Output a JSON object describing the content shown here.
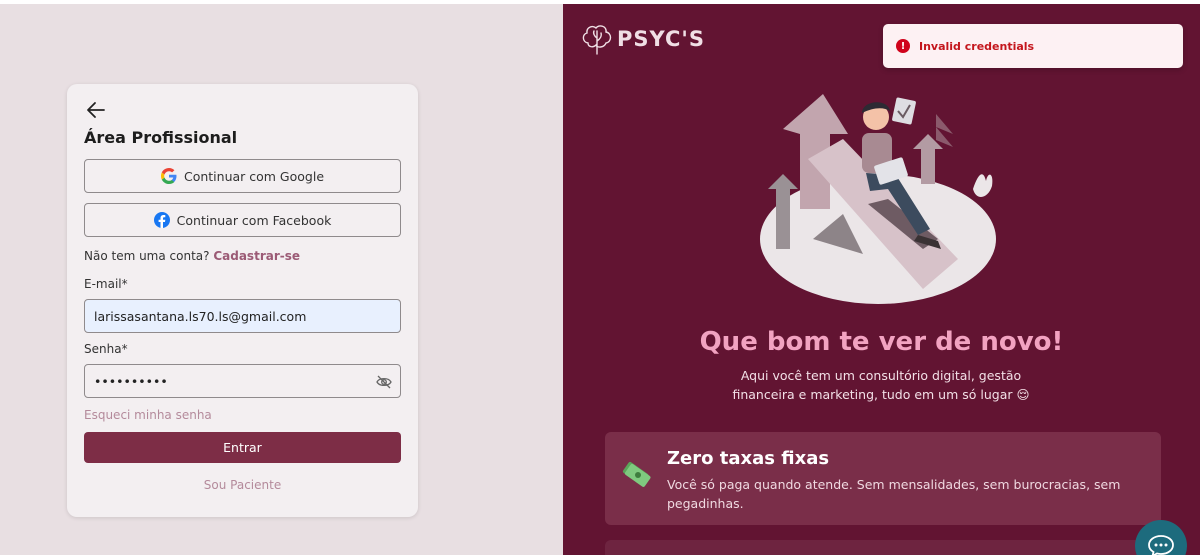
{
  "login": {
    "title": "Área Profissional",
    "google_label": "Continuar com Google",
    "facebook_label": "Continuar com Facebook",
    "signup_prompt": "Não tem uma conta?",
    "signup_link": "Cadastrar-se",
    "email_label": "E-mail*",
    "email_value": "larissasantana.ls70.ls@gmail.com",
    "password_label": "Senha*",
    "password_value": "••••••••••",
    "forgot_label": "Esqueci minha senha",
    "submit_label": "Entrar",
    "patient_label": "Sou Paciente"
  },
  "brand": {
    "name": "PSYC'S"
  },
  "toast": {
    "message": "Invalid credentials",
    "icon": "error-icon"
  },
  "hero": {
    "headline": "Que bom te ver de novo!",
    "subtext": "Aqui você tem um consultório digital, gestão financeira e marketing, tudo em um só lugar 😌"
  },
  "features": [
    {
      "title": "Zero taxas fixas",
      "description": "Você só paga quando atende. Sem mensalidades, sem burocracias, sem pegadinhas.",
      "icon": "money-icon"
    }
  ],
  "colors": {
    "brand": "#621432",
    "accent": "#7d2d46",
    "toast_error": "#c4161c",
    "left_bg": "#e8dfe2"
  }
}
